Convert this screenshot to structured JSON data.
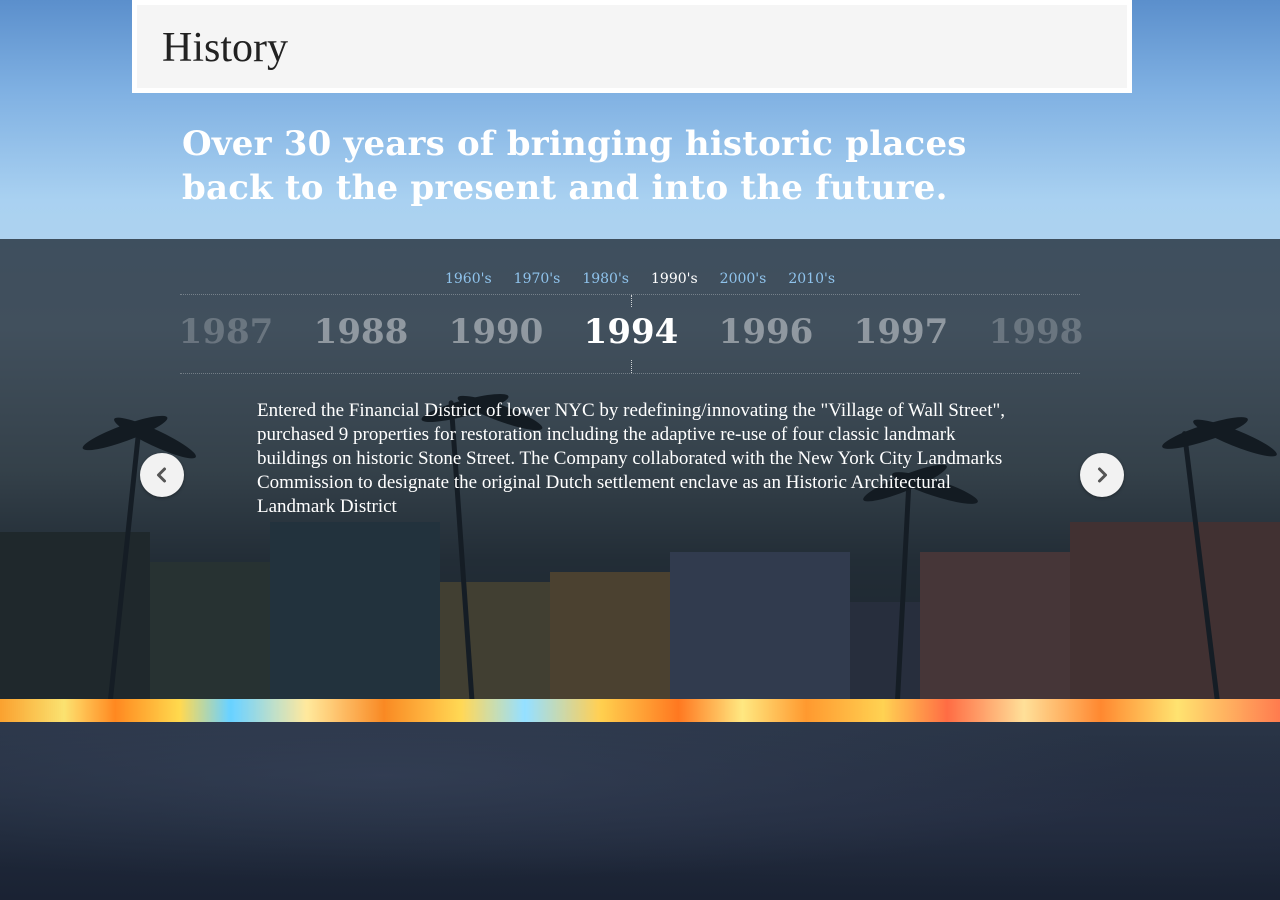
{
  "header": {
    "title": "History"
  },
  "hero": {
    "tagline_line1": "Over 30 years of bringing historic places",
    "tagline_line2": "back to the present and into the future."
  },
  "timeline": {
    "decades": [
      {
        "label": "1960's",
        "active": false
      },
      {
        "label": "1970's",
        "active": false
      },
      {
        "label": "1980's",
        "active": false
      },
      {
        "label": "1990's",
        "active": true
      },
      {
        "label": "2000's",
        "active": false
      },
      {
        "label": "2010's",
        "active": false
      }
    ],
    "years": [
      "1987",
      "1988",
      "1990",
      "1994",
      "1996",
      "1997",
      "1998"
    ],
    "selected_year": "1994",
    "event_text": "Entered the Financial District of lower NYC by redefining/innovating the \"Village of Wall Street\", purchased 9 properties for restoration including the adaptive re-use of four classic landmark buildings on historic Stone Street. The Company collaborated with the New York City Landmarks Commission to designate the original Dutch settlement enclave as an Historic Architectural Landmark District",
    "prev_icon": "chevron-left-icon",
    "next_icon": "chevron-right-icon"
  },
  "colors": {
    "decade_link": "#8fc3ec",
    "decade_active": "#ffffff",
    "overlay": "#141c26",
    "nav_button": "#f2f2f2"
  }
}
